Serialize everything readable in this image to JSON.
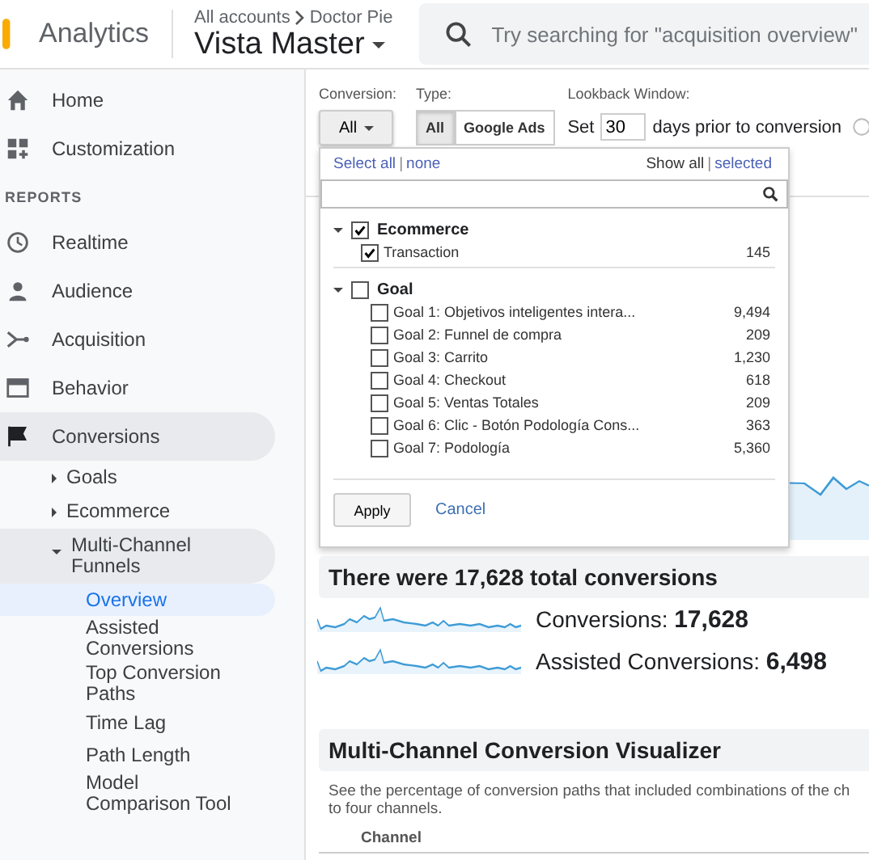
{
  "header": {
    "product": "Analytics",
    "breadcrumb": [
      "All accounts",
      "Doctor Pie"
    ],
    "view": "Vista Master",
    "search": {
      "placeholder": "Try searching for \"acquisition overview\""
    }
  },
  "sidebar": {
    "top_items": [
      {
        "label": "Home",
        "selected": false
      },
      {
        "label": "Customization",
        "selected": false
      }
    ],
    "section_label": "REPORTS",
    "items": [
      {
        "label": "Realtime",
        "selected": false
      },
      {
        "label": "Audience",
        "selected": false
      },
      {
        "label": "Acquisition",
        "selected": false
      },
      {
        "label": "Behavior",
        "selected": false
      },
      {
        "label": "Conversions",
        "selected": true,
        "children": [
          {
            "label": "Goals",
            "selected": false,
            "expanded": false
          },
          {
            "label": "Ecommerce",
            "selected": false,
            "expanded": false
          },
          {
            "label": "Multi-Channel Funnels",
            "selected": true,
            "expanded": true,
            "children": [
              {
                "label": "Overview",
                "selected": true
              },
              {
                "label": "Assisted Conversions",
                "selected": false
              },
              {
                "label": "Top Conversion Paths",
                "selected": false
              },
              {
                "label": "Time Lag",
                "selected": false
              },
              {
                "label": "Path Length",
                "selected": false
              },
              {
                "label": "Model Comparison Tool",
                "selected": false
              }
            ]
          }
        ]
      }
    ]
  },
  "controls": {
    "conversion_label": "Conversion:",
    "conversion_value": "All",
    "type_label": "Type:",
    "type_options": [
      {
        "label": "All",
        "selected": true
      },
      {
        "label": "Google Ads",
        "selected": false
      }
    ],
    "lookback_label": "Lookback Window:",
    "lookback_prefix": "Set",
    "lookback_value": "30",
    "lookback_suffix": "days prior to conversion"
  },
  "dropdown": {
    "separator": "|",
    "select_all": "Select all",
    "select_none": "none",
    "view_options": [
      {
        "label": "Show all",
        "selected": true
      },
      {
        "label": "selected",
        "selected": false
      }
    ],
    "groups": [
      {
        "name": "Ecommerce",
        "checked": true,
        "expanded": true,
        "items": [
          {
            "label": "Transaction",
            "count": "145",
            "checked": true
          }
        ]
      },
      {
        "name": "Goal",
        "checked": false,
        "expanded": true,
        "items": [
          {
            "label": "Goal 1: Objetivos inteligentes intera...",
            "count": "9,494",
            "checked": false
          },
          {
            "label": "Goal 2: Funnel de compra",
            "count": "209",
            "checked": false
          },
          {
            "label": "Goal 3: Carrito",
            "count": "1,230",
            "checked": false
          },
          {
            "label": "Goal 4: Checkout",
            "count": "618",
            "checked": false
          },
          {
            "label": "Goal 5: Ventas Totales",
            "count": "209",
            "checked": false
          },
          {
            "label": "Goal 6: Clic - Botón Podología Cons...",
            "count": "363",
            "checked": false
          },
          {
            "label": "Goal 7: Podología",
            "count": "5,360",
            "checked": false
          }
        ]
      }
    ],
    "apply": "Apply",
    "cancel": "Cancel"
  },
  "summary": {
    "title": "There were 17,628 total conversions",
    "metrics": [
      {
        "label": "Conversions:",
        "value": "17,628"
      },
      {
        "label": "Assisted Conversions:",
        "value": "6,498"
      }
    ]
  },
  "visualizer": {
    "title": "Multi-Channel Conversion Visualizer",
    "description_lines": [
      "See the percentage of conversion paths that included combinations of the ch",
      "to four channels."
    ],
    "column": "Channel"
  }
}
